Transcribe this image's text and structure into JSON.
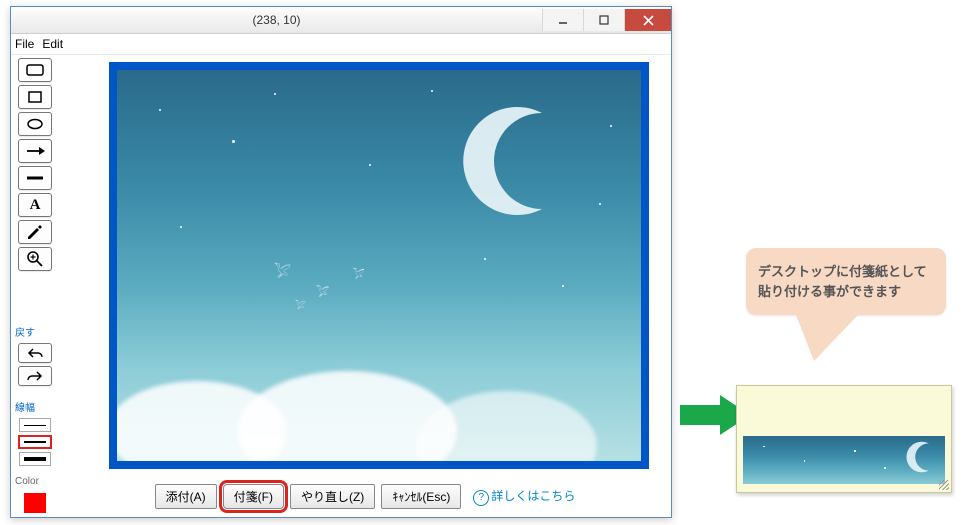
{
  "window": {
    "title": "(238, 10)",
    "menu": {
      "file": "File",
      "edit": "Edit"
    }
  },
  "toolbar": {
    "undo_label": "戻す",
    "line_width_label": "線幅",
    "color_label": "Color",
    "selected_color": "#ff0000"
  },
  "buttons": {
    "attach": "添付(A)",
    "sticky": "付箋(F)",
    "undo": "やり直し(Z)",
    "cancel": "ｷｬﾝｾﾙ(Esc)",
    "help": "詳しくはこちら"
  },
  "callout": {
    "line1": "デスクトップに付箋紙として",
    "line2": "貼り付ける事ができます"
  }
}
